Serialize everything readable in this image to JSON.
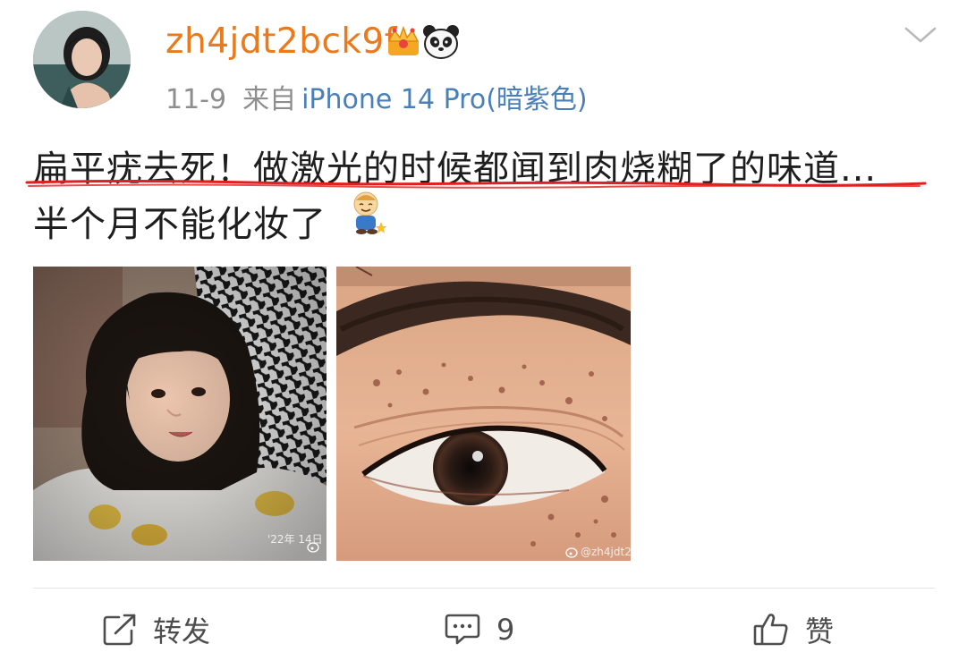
{
  "post": {
    "username": "zh4jdt2bck9f",
    "date": "11-9",
    "from_label": "来自",
    "device": "iPhone 14 Pro(暗紫色)",
    "text_line1": "扁平疣去死！做激光的时候都闻到肉烧糊了的味道...",
    "text_line2": "半个月不能化妆了",
    "photos": [
      {
        "watermark": "'22年 14日"
      },
      {
        "watermark": "@zh4jdt2bc"
      }
    ]
  },
  "actions": {
    "repost_label": "转发",
    "comment_count": "9",
    "like_label": "赞"
  },
  "colors": {
    "username": "#ea7a1c",
    "device_link": "#4a7fb8",
    "underline": "#e02020",
    "meta_gray": "#8e8e8e"
  },
  "icons": [
    "crown-badge-icon",
    "panda-badge-icon",
    "chevron-down-icon",
    "repost-icon",
    "comment-icon",
    "like-icon",
    "smiling-boy-emoji"
  ]
}
